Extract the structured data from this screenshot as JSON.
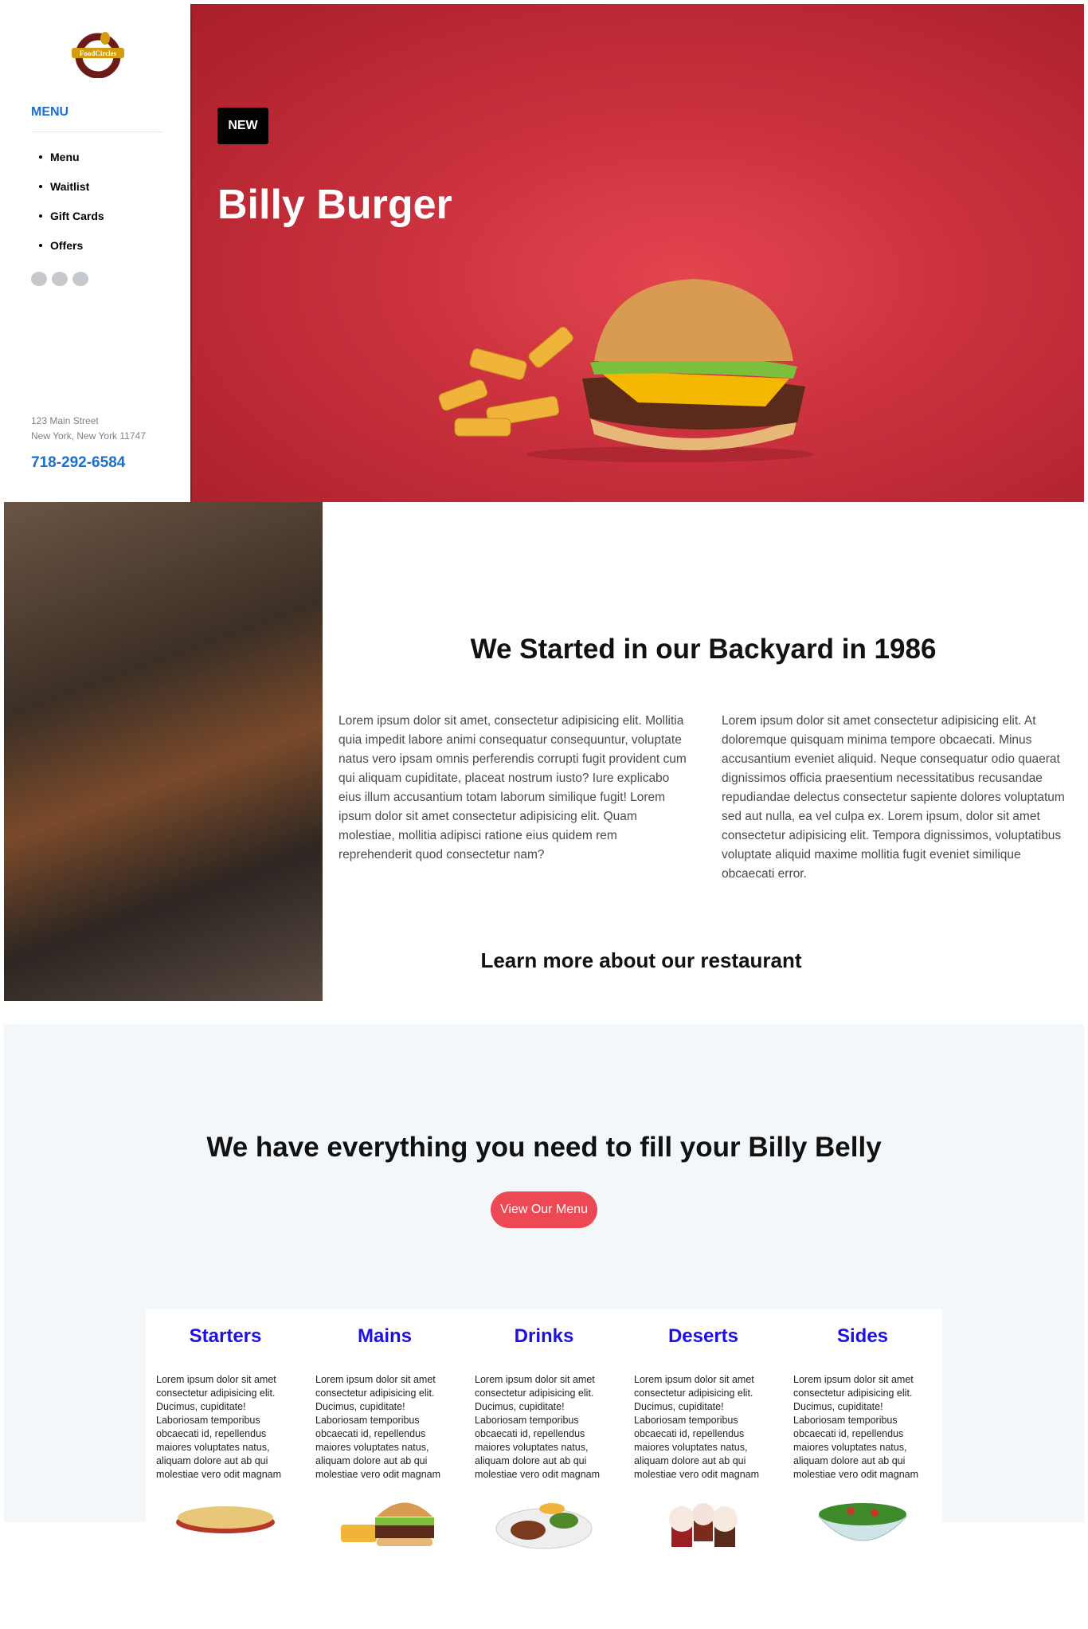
{
  "sidebar": {
    "logo_text": "FoodCircles",
    "menu_title": "MENU",
    "nav": [
      "Menu",
      "Waitlist",
      "Gift Cards",
      "Offers"
    ],
    "address_line1": "123 Main Street",
    "address_line2": "New York, New York 11747",
    "phone": "718-292-6584"
  },
  "hero": {
    "badge": "NEW",
    "title": "Billy Burger"
  },
  "about": {
    "title": "We Started in our Backyard in 1986",
    "para1": "Lorem ipsum dolor sit amet, consectetur adipisicing elit. Mollitia quia impedit labore animi consequatur consequuntur, voluptate natus vero ipsam omnis perferendis corrupti fugit provident cum qui aliquam cupiditate, placeat nostrum iusto? Iure explicabo eius illum accusantium totam laborum similique fugit! Lorem ipsum dolor sit amet consectetur adipisicing elit. Quam molestiae, mollitia adipisci ratione eius quidem rem reprehenderit quod consectetur nam?",
    "para2": "Lorem ipsum dolor sit amet consectetur adipisicing elit. At doloremque quisquam minima tempore obcaecati. Minus accusantium eveniet aliquid. Neque consequatur odio quaerat dignissimos officia praesentium necessitatibus recusandae repudiandae delectus consectetur sapiente dolores voluptatum sed aut nulla, ea vel culpa ex. Lorem ipsum, dolor sit amet consectetur adipisicing elit. Tempora dignissimos, voluptatibus voluptate aliquid maxime mollitia fugit eveniet similique obcaecati error.",
    "learn_more": "Learn more about our restaurant"
  },
  "menu_section": {
    "title": "We have everything you need to fill your Billy Belly",
    "button": "View Our Menu",
    "categories": [
      {
        "title": "Starters",
        "text": "Lorem ipsum dolor sit amet consectetur adipisicing elit. Ducimus, cupiditate! Laboriosam temporibus obcaecati id, repellendus maiores voluptates natus, aliquam dolore aut ab qui molestiae vero odit magnam"
      },
      {
        "title": "Mains",
        "text": "Lorem ipsum dolor sit amet consectetur adipisicing elit. Ducimus, cupiditate! Laboriosam temporibus obcaecati id, repellendus maiores voluptates natus, aliquam dolore aut ab qui molestiae vero odit magnam"
      },
      {
        "title": "Drinks",
        "text": "Lorem ipsum dolor sit amet consectetur adipisicing elit. Ducimus, cupiditate! Laboriosam temporibus obcaecati id, repellendus maiores voluptates natus, aliquam dolore aut ab qui molestiae vero odit magnam"
      },
      {
        "title": "Deserts",
        "text": "Lorem ipsum dolor sit amet consectetur adipisicing elit. Ducimus, cupiditate! Laboriosam temporibus obcaecati id, repellendus maiores voluptates natus, aliquam dolore aut ab qui molestiae vero odit magnam"
      },
      {
        "title": "Sides",
        "text": "Lorem ipsum dolor sit amet consectetur adipisicing elit. Ducimus, cupiditate! Laboriosam temporibus obcaecati id, repellendus maiores voluptates natus, aliquam dolore aut ab qui molestiae vero odit magnam"
      }
    ]
  },
  "colors": {
    "accent_blue": "#1a6fd0",
    "hero_red": "#c8303c",
    "button_red": "#ec4955",
    "category_blue": "#1d0fe6"
  }
}
